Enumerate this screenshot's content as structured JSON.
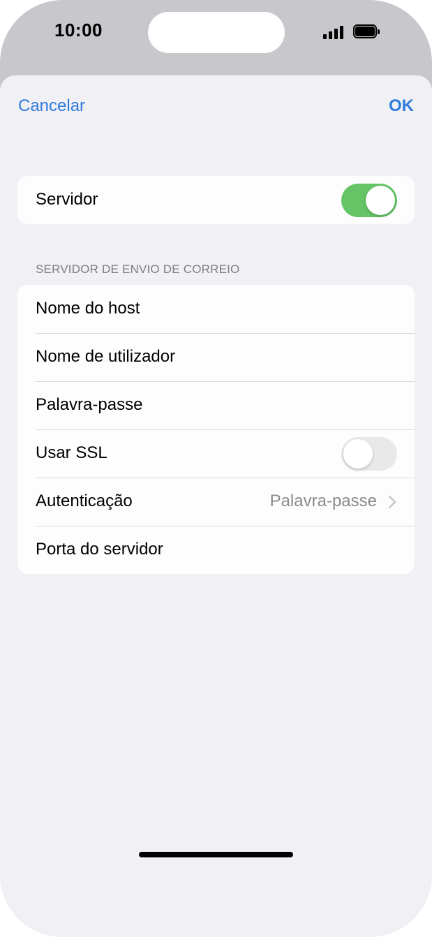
{
  "status_bar": {
    "time": "10:00"
  },
  "nav": {
    "cancel_label": "Cancelar",
    "ok_label": "OK"
  },
  "server_group": {
    "label": "Servidor",
    "enabled": true
  },
  "smtp_section": {
    "header": "SERVIDOR DE ENVIO DE CORREIO",
    "rows": [
      {
        "label": "Nome do host"
      },
      {
        "label": "Nome de utilizador"
      },
      {
        "label": "Palavra-passe"
      },
      {
        "label": "Usar SSL",
        "enabled": false
      },
      {
        "label": "Autenticação",
        "value": "Palavra-passe"
      },
      {
        "label": "Porta do servidor"
      }
    ]
  },
  "colors": {
    "accent": "#2f7bdc",
    "toggle_on": "#65c466",
    "toggle_off": "#e9e9ea",
    "background": "#f0f0f5"
  },
  "icons": [
    "signal-icon",
    "battery-icon",
    "chevron-right-icon"
  ]
}
